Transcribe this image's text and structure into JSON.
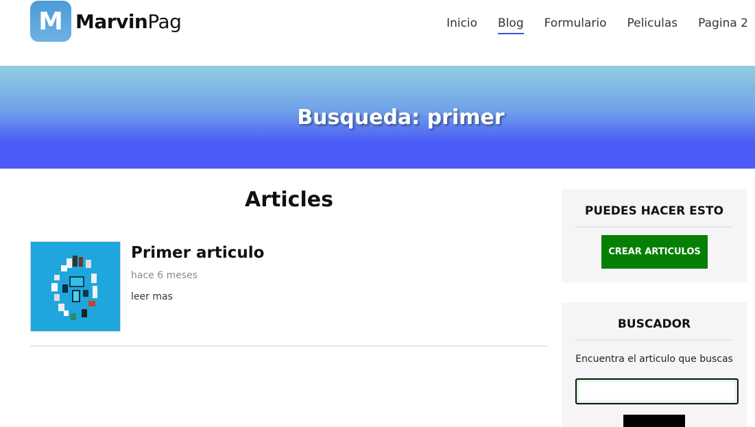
{
  "header": {
    "logo_letter": "M",
    "logo_bold": "Marvin",
    "logo_light": "Pag",
    "nav": [
      {
        "label": "Inicio"
      },
      {
        "label": "Blog"
      },
      {
        "label": "Formulario"
      },
      {
        "label": "Peliculas"
      },
      {
        "label": "Pagina 2"
      }
    ]
  },
  "banner": {
    "title": "Busqueda: primer"
  },
  "main": {
    "title": "Articles",
    "articles": [
      {
        "title": "Primer articulo",
        "date": "hace 6 meses",
        "link": "leer mas",
        "image_icon": "smart-home-devices-illustration"
      }
    ]
  },
  "sidebar": {
    "actions": {
      "title": "PUEDES HACER ESTO",
      "button": "CREAR ARTICULOS"
    },
    "search": {
      "title": "BUSCADOR",
      "description": "Encuentra el articulo que buscas",
      "value": "",
      "button": ""
    }
  },
  "colors": {
    "nav_active_underline": "#3a4fd6",
    "banner_top": "#92cfe0",
    "banner_bottom": "#4a5bf8",
    "create_button": "#058005",
    "sidebar_bg": "#f5f5f5"
  }
}
